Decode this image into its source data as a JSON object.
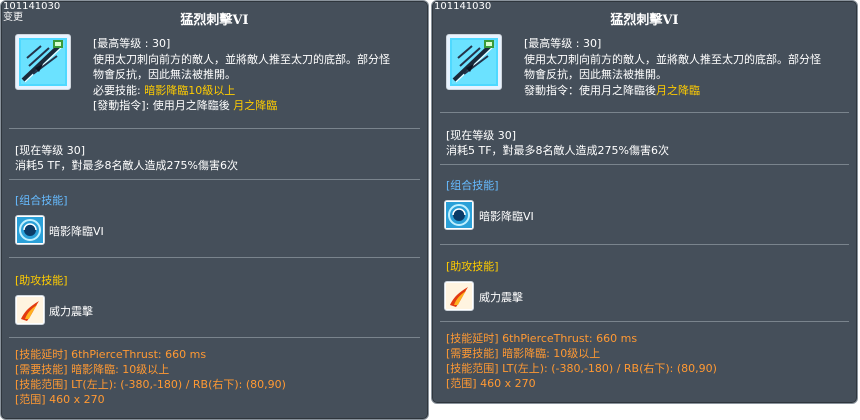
{
  "left": {
    "id": "101141030",
    "changed": "变更",
    "title": "猛烈刺擊VI",
    "desc": [
      "[最高等级 : 30]",
      "使用太刀刺向前方的敵人，並將敵人推至太刀的底部。部分怪",
      "物會反抗，因此無法被推開。"
    ],
    "required_label": "必要技能: ",
    "required_value": "暗影降臨10級以上",
    "command_label": "[發動指令]: 使用月之降臨後 ",
    "command_value": "月之降臨",
    "current_level": "[现在等级 30]",
    "current_effect": "消耗5 TF，對最多8名敵人造成275%傷害6次",
    "combo_header": "[组合技能]",
    "combo_skill": "暗影降臨VI",
    "assist_header": "[助攻技能]",
    "assist_skill": "威力震擊",
    "info": [
      "[技能延时] 6thPierceThrust: 660 ms",
      "[需要技能] 暗影降臨: 10级以上",
      "[技能范围] LT(左上): (-380,-180) / RB(右下): (80,90)",
      "[范围] 460 x 270"
    ]
  },
  "right": {
    "id": "101141030",
    "title": "猛烈刺擊VI",
    "desc": [
      "[最高等级 : 30]",
      "使用太刀刺向前方的敵人，並將敵人推至太刀的底部。部分怪",
      "物會反抗，因此無法被推開。"
    ],
    "command_label": "發動指令：使用月之降臨後",
    "command_value": "月之降臨",
    "current_level": "[现在等级 30]",
    "current_effect": "消耗5 TF，對最多8名敵人造成275%傷害6次",
    "combo_header": "[组合技能]",
    "combo_skill": "暗影降臨VI",
    "assist_header": "[助攻技能]",
    "assist_skill": "威力震擊",
    "info": [
      "[技能延时] 6thPierceThrust: 660 ms",
      "[需要技能] 暗影降臨: 10级以上",
      "[技能范围] LT(左上): (-380,-180) / RB(右下): (80,90)",
      "[范围] 460 x 270"
    ]
  },
  "colors": {
    "panel_bg": "#454f5a",
    "yellow": "#ffcc00",
    "orange": "#ff9933",
    "blue": "#66bbff"
  },
  "icons": {
    "main": "crossed-blades-icon",
    "combo": "dark-vortex-icon",
    "assist": "flame-slash-icon"
  }
}
